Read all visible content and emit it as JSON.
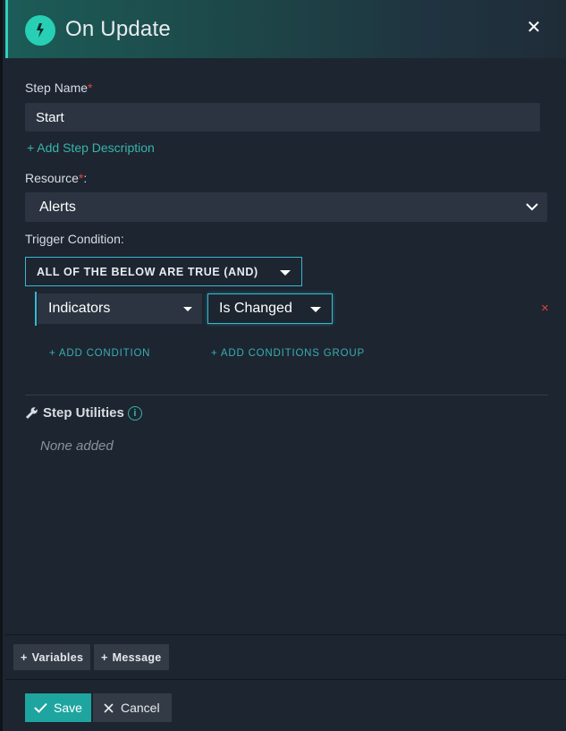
{
  "header": {
    "title": "On Update",
    "icon": "lightning-bolt-icon",
    "close_icon": "close-icon"
  },
  "step_name": {
    "label": "Step Name",
    "required_mark": "*",
    "value": "Start"
  },
  "add_description": {
    "label": "+ Add Step Description"
  },
  "resource": {
    "label": "Resource",
    "required_mark": "*",
    "suffix": ":",
    "value": "Alerts"
  },
  "trigger": {
    "label": "Trigger Condition:",
    "operator": "ALL OF THE BELOW ARE TRUE (AND)",
    "conditions": [
      {
        "field": "Indicators",
        "operator": "Is Changed"
      }
    ],
    "remove_icon": "×",
    "add_condition": "ADD CONDITION",
    "add_group": "ADD CONDITIONS GROUP"
  },
  "utilities": {
    "title": "Step Utilities",
    "info_icon": "i",
    "empty_text": "None added"
  },
  "toolbar": {
    "variables": "Variables",
    "message": "Message"
  },
  "footer": {
    "save": "Save",
    "cancel": "Cancel"
  },
  "colors": {
    "accent": "#27cfb5",
    "teal_link": "#38b4ad",
    "focus_border": "#35b9d1",
    "danger": "#d9453f",
    "save_bg": "#1fa5a0"
  }
}
